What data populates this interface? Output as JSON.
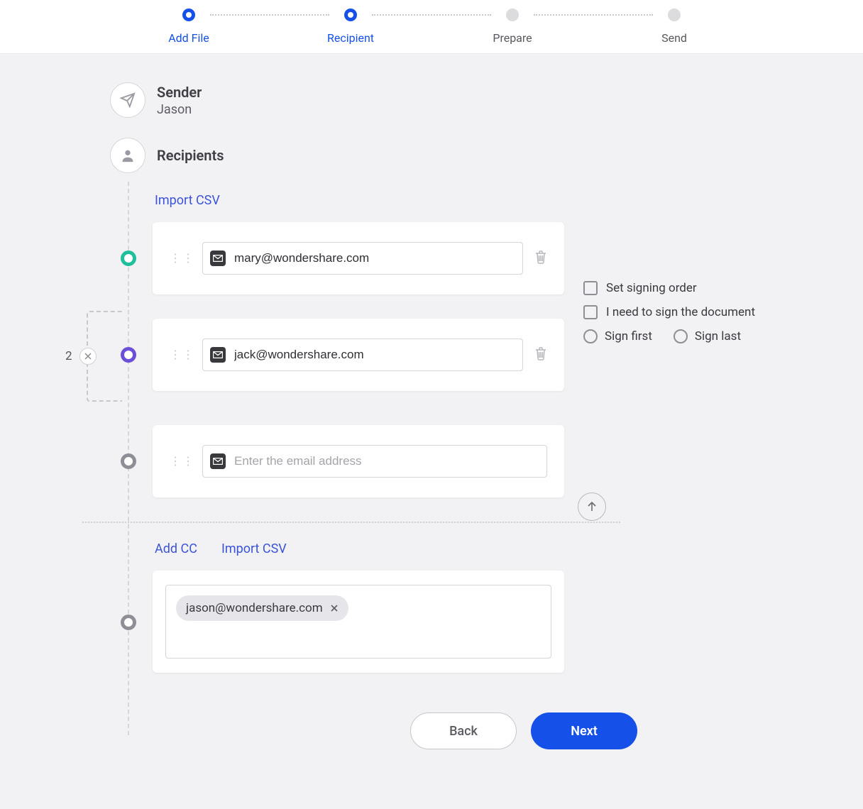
{
  "stepper": {
    "steps": [
      {
        "label": "Add File",
        "active": true
      },
      {
        "label": "Recipient",
        "active": true
      },
      {
        "label": "Prepare",
        "active": false
      },
      {
        "label": "Send",
        "active": false
      }
    ]
  },
  "sender": {
    "title": "Sender",
    "name": "Jason"
  },
  "recipients": {
    "title": "Recipients",
    "import_label": "Import CSV",
    "group_count": "2",
    "rows": [
      {
        "email": "mary@wondershare.com",
        "color": "teal"
      },
      {
        "email": "jack@wondershare.com",
        "color": "purple"
      },
      {
        "email": "",
        "placeholder": "Enter the email address",
        "color": "gray"
      }
    ]
  },
  "options": {
    "set_order": "Set signing order",
    "need_sign": "I need to sign the document",
    "sign_first": "Sign first",
    "sign_last": "Sign last"
  },
  "cc": {
    "add_label": "Add CC",
    "import_label": "Import CSV",
    "chips": [
      "jason@wondershare.com"
    ]
  },
  "footer": {
    "back": "Back",
    "next": "Next"
  }
}
